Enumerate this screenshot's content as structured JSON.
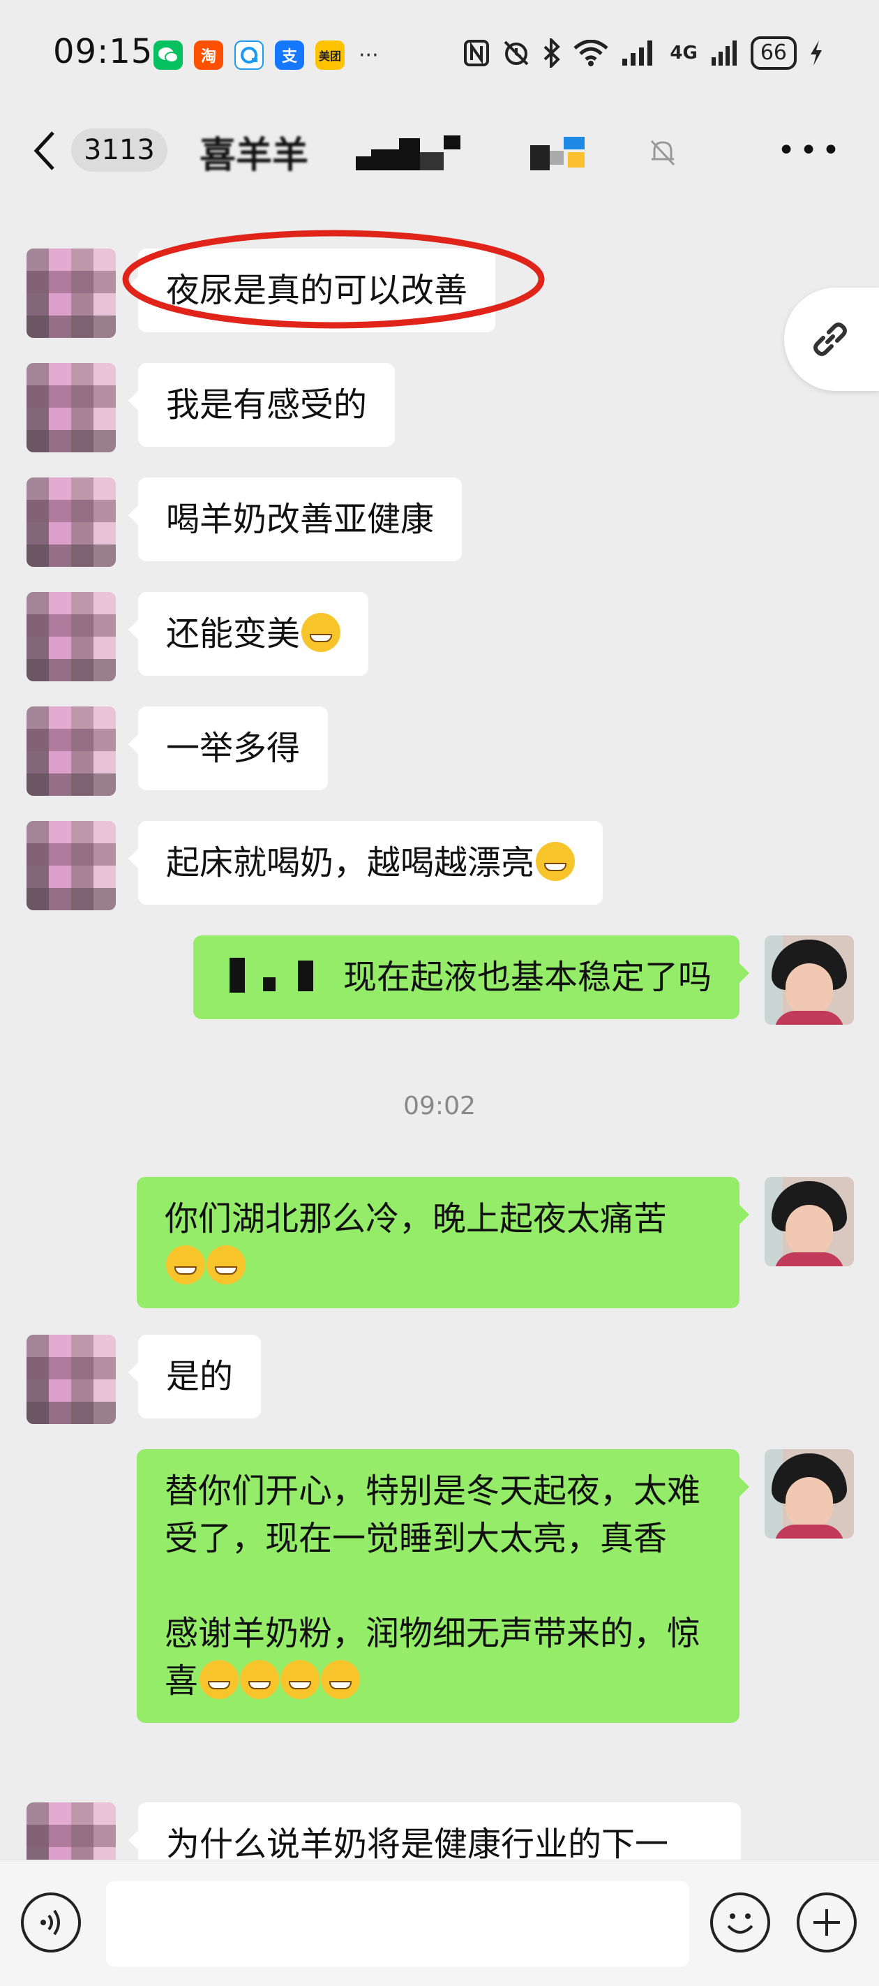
{
  "status": {
    "time": "09:15",
    "app_icons": [
      {
        "name": "wechat-icon",
        "label": "",
        "color": "#07c160"
      },
      {
        "name": "taobao-icon",
        "label": "淘",
        "color": "#ff5000"
      },
      {
        "name": "qq-icon",
        "label": "",
        "color": "#1e9bf0"
      },
      {
        "name": "alipay-icon",
        "label": "支",
        "color": "#1677ff"
      },
      {
        "name": "meituan-icon",
        "label": "美团",
        "color": "#ffc300"
      }
    ],
    "more": "···",
    "network": "4G",
    "battery": "66"
  },
  "header": {
    "unread_count": "3113",
    "title": "喜羊羊"
  },
  "messages": [
    {
      "side": "in",
      "text": "夜尿是真的可以改善"
    },
    {
      "side": "in",
      "text": "我是有感受的"
    },
    {
      "side": "in",
      "text": "喝羊奶改善亚健康"
    },
    {
      "side": "in",
      "text": "还能变美"
    },
    {
      "side": "in",
      "text": "一举多得"
    },
    {
      "side": "in",
      "text": "起床就喝奶，越喝越漂亮"
    },
    {
      "side": "out",
      "text": "现在起液也基本稳定了吗"
    },
    {
      "side": "out",
      "text": "你们湖北那么冷，晚上起夜太痛苦"
    },
    {
      "side": "in",
      "text": "是的"
    },
    {
      "side": "out",
      "text": "替你们开心，特别是冬天起夜，太难受了，现在一觉睡到大太亮，真香\n\n感谢羊奶粉，润物细无声带来的，惊喜"
    },
    {
      "side": "in",
      "text": "为什么说羊奶将是健康行业的下一"
    }
  ],
  "timestamp": "09:02",
  "colors": {
    "bubble_out": "#95ec69",
    "bubble_in": "#ffffff",
    "background": "#ededed",
    "highlight": "#e0241a"
  }
}
